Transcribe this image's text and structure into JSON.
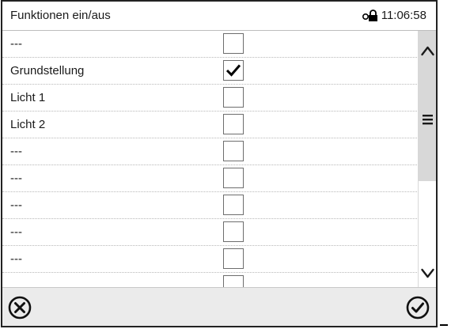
{
  "header": {
    "title": "Funktionen ein/aus",
    "time": "11:06:58",
    "status_icon": "lock-icon"
  },
  "rows": [
    {
      "label": "---",
      "checked": false
    },
    {
      "label": "Grundstellung",
      "checked": true
    },
    {
      "label": "Licht 1",
      "checked": false
    },
    {
      "label": "Licht 2",
      "checked": false
    },
    {
      "label": "---",
      "checked": false
    },
    {
      "label": "---",
      "checked": false
    },
    {
      "label": "---",
      "checked": false
    },
    {
      "label": "---",
      "checked": false
    },
    {
      "label": "---",
      "checked": false
    },
    {
      "label": "",
      "checked": false
    }
  ],
  "scrollbar": {
    "up_icon": "chevron-up-icon",
    "thumb_icon": "menu-icon",
    "down_icon": "chevron-down-icon"
  },
  "footer": {
    "cancel_icon": "close-circle-icon",
    "confirm_icon": "check-circle-icon"
  }
}
